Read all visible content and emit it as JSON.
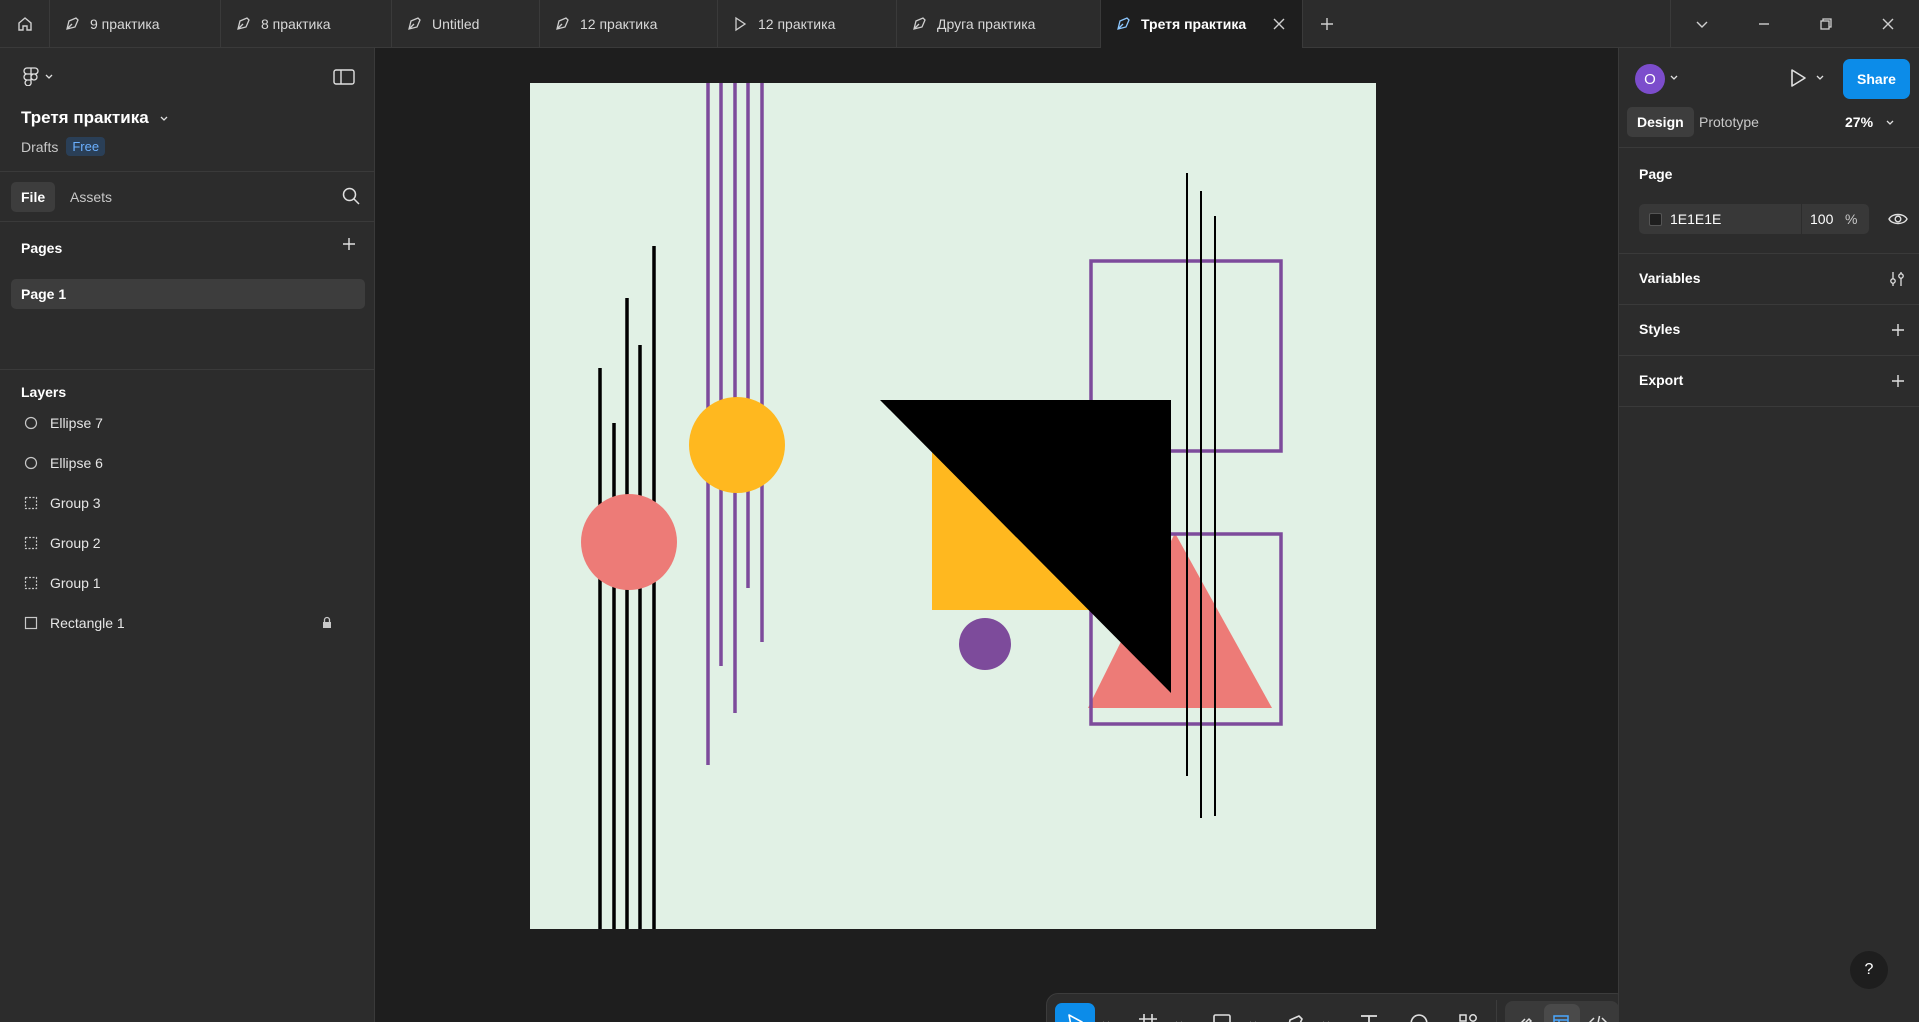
{
  "tabs": [
    {
      "label": "9 практика",
      "icon": "pen-tool-icon"
    },
    {
      "label": "8 практика",
      "icon": "pen-tool-icon"
    },
    {
      "label": "Untitled",
      "icon": "pen-tool-icon"
    },
    {
      "label": "12 практика",
      "icon": "pen-tool-icon"
    },
    {
      "label": "12 практика",
      "icon": "play-icon"
    },
    {
      "label": "Друга практика",
      "icon": "pen-tool-icon"
    },
    {
      "label": "Третя практика",
      "icon": "pen-tool-icon",
      "active": true
    }
  ],
  "file": {
    "title": "Третя практика",
    "location": "Drafts",
    "plan_badge": "Free"
  },
  "left_tabs": {
    "file": "File",
    "assets": "Assets"
  },
  "pages": {
    "title": "Pages",
    "items": [
      "Page 1"
    ]
  },
  "layers": {
    "title": "Layers",
    "items": [
      {
        "name": "Ellipse 7",
        "icon": "ellipse-icon"
      },
      {
        "name": "Ellipse 6",
        "icon": "ellipse-icon"
      },
      {
        "name": "Group 3",
        "icon": "group-icon"
      },
      {
        "name": "Group 2",
        "icon": "group-icon"
      },
      {
        "name": "Group 1",
        "icon": "group-icon"
      },
      {
        "name": "Rectangle 1",
        "icon": "rectangle-icon",
        "locked": true
      }
    ]
  },
  "right_panel": {
    "avatar_letter": "O",
    "share_label": "Share",
    "tabs": {
      "design": "Design",
      "prototype": "Prototype"
    },
    "zoom": "27%",
    "page": {
      "title": "Page",
      "color_hex": "1E1E1E",
      "opacity": "100",
      "percent": "%"
    },
    "variables": "Variables",
    "styles": "Styles",
    "export": "Export",
    "help": "?"
  },
  "colors": {
    "accent": "#0c8ce9",
    "frame_bg": "#e1f1e5",
    "purple": "#7d4b9b",
    "yellow": "#ffb81f",
    "coral": "#ed7b77",
    "black": "#000000"
  }
}
